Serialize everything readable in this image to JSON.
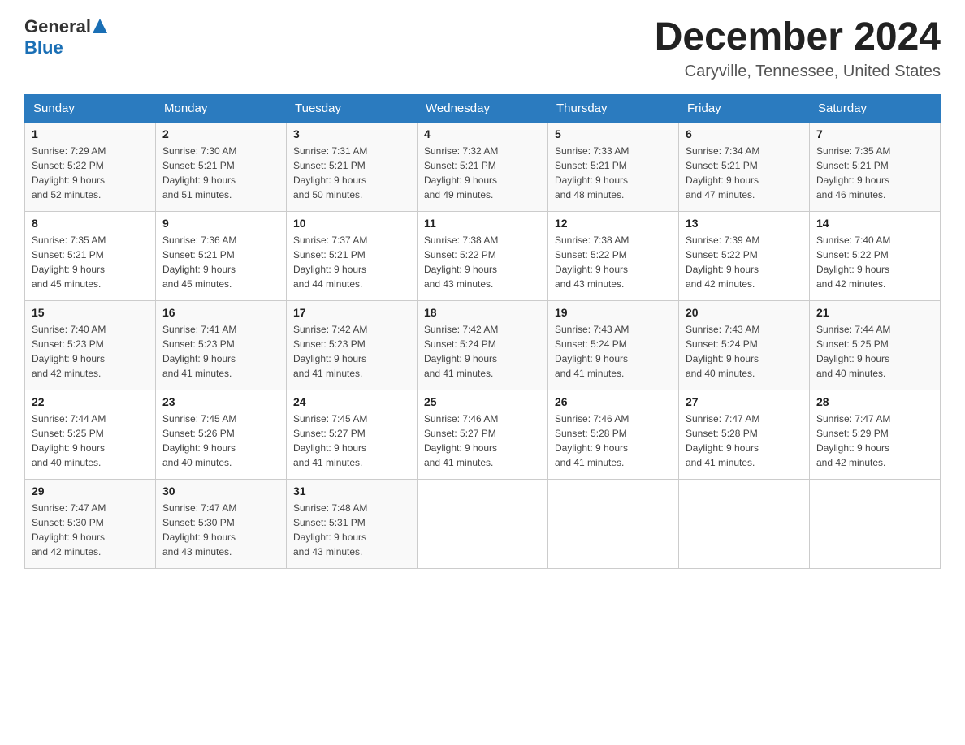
{
  "header": {
    "logo_general": "General",
    "logo_blue": "Blue",
    "month_title": "December 2024",
    "location": "Caryville, Tennessee, United States"
  },
  "days_of_week": [
    "Sunday",
    "Monday",
    "Tuesday",
    "Wednesday",
    "Thursday",
    "Friday",
    "Saturday"
  ],
  "weeks": [
    [
      {
        "day": "1",
        "sunrise": "7:29 AM",
        "sunset": "5:22 PM",
        "daylight": "9 hours and 52 minutes."
      },
      {
        "day": "2",
        "sunrise": "7:30 AM",
        "sunset": "5:21 PM",
        "daylight": "9 hours and 51 minutes."
      },
      {
        "day": "3",
        "sunrise": "7:31 AM",
        "sunset": "5:21 PM",
        "daylight": "9 hours and 50 minutes."
      },
      {
        "day": "4",
        "sunrise": "7:32 AM",
        "sunset": "5:21 PM",
        "daylight": "9 hours and 49 minutes."
      },
      {
        "day": "5",
        "sunrise": "7:33 AM",
        "sunset": "5:21 PM",
        "daylight": "9 hours and 48 minutes."
      },
      {
        "day": "6",
        "sunrise": "7:34 AM",
        "sunset": "5:21 PM",
        "daylight": "9 hours and 47 minutes."
      },
      {
        "day": "7",
        "sunrise": "7:35 AM",
        "sunset": "5:21 PM",
        "daylight": "9 hours and 46 minutes."
      }
    ],
    [
      {
        "day": "8",
        "sunrise": "7:35 AM",
        "sunset": "5:21 PM",
        "daylight": "9 hours and 45 minutes."
      },
      {
        "day": "9",
        "sunrise": "7:36 AM",
        "sunset": "5:21 PM",
        "daylight": "9 hours and 45 minutes."
      },
      {
        "day": "10",
        "sunrise": "7:37 AM",
        "sunset": "5:21 PM",
        "daylight": "9 hours and 44 minutes."
      },
      {
        "day": "11",
        "sunrise": "7:38 AM",
        "sunset": "5:22 PM",
        "daylight": "9 hours and 43 minutes."
      },
      {
        "day": "12",
        "sunrise": "7:38 AM",
        "sunset": "5:22 PM",
        "daylight": "9 hours and 43 minutes."
      },
      {
        "day": "13",
        "sunrise": "7:39 AM",
        "sunset": "5:22 PM",
        "daylight": "9 hours and 42 minutes."
      },
      {
        "day": "14",
        "sunrise": "7:40 AM",
        "sunset": "5:22 PM",
        "daylight": "9 hours and 42 minutes."
      }
    ],
    [
      {
        "day": "15",
        "sunrise": "7:40 AM",
        "sunset": "5:23 PM",
        "daylight": "9 hours and 42 minutes."
      },
      {
        "day": "16",
        "sunrise": "7:41 AM",
        "sunset": "5:23 PM",
        "daylight": "9 hours and 41 minutes."
      },
      {
        "day": "17",
        "sunrise": "7:42 AM",
        "sunset": "5:23 PM",
        "daylight": "9 hours and 41 minutes."
      },
      {
        "day": "18",
        "sunrise": "7:42 AM",
        "sunset": "5:24 PM",
        "daylight": "9 hours and 41 minutes."
      },
      {
        "day": "19",
        "sunrise": "7:43 AM",
        "sunset": "5:24 PM",
        "daylight": "9 hours and 41 minutes."
      },
      {
        "day": "20",
        "sunrise": "7:43 AM",
        "sunset": "5:24 PM",
        "daylight": "9 hours and 40 minutes."
      },
      {
        "day": "21",
        "sunrise": "7:44 AM",
        "sunset": "5:25 PM",
        "daylight": "9 hours and 40 minutes."
      }
    ],
    [
      {
        "day": "22",
        "sunrise": "7:44 AM",
        "sunset": "5:25 PM",
        "daylight": "9 hours and 40 minutes."
      },
      {
        "day": "23",
        "sunrise": "7:45 AM",
        "sunset": "5:26 PM",
        "daylight": "9 hours and 40 minutes."
      },
      {
        "day": "24",
        "sunrise": "7:45 AM",
        "sunset": "5:27 PM",
        "daylight": "9 hours and 41 minutes."
      },
      {
        "day": "25",
        "sunrise": "7:46 AM",
        "sunset": "5:27 PM",
        "daylight": "9 hours and 41 minutes."
      },
      {
        "day": "26",
        "sunrise": "7:46 AM",
        "sunset": "5:28 PM",
        "daylight": "9 hours and 41 minutes."
      },
      {
        "day": "27",
        "sunrise": "7:47 AM",
        "sunset": "5:28 PM",
        "daylight": "9 hours and 41 minutes."
      },
      {
        "day": "28",
        "sunrise": "7:47 AM",
        "sunset": "5:29 PM",
        "daylight": "9 hours and 42 minutes."
      }
    ],
    [
      {
        "day": "29",
        "sunrise": "7:47 AM",
        "sunset": "5:30 PM",
        "daylight": "9 hours and 42 minutes."
      },
      {
        "day": "30",
        "sunrise": "7:47 AM",
        "sunset": "5:30 PM",
        "daylight": "9 hours and 43 minutes."
      },
      {
        "day": "31",
        "sunrise": "7:48 AM",
        "sunset": "5:31 PM",
        "daylight": "9 hours and 43 minutes."
      },
      null,
      null,
      null,
      null
    ]
  ],
  "labels": {
    "sunrise": "Sunrise:",
    "sunset": "Sunset:",
    "daylight": "Daylight:"
  }
}
